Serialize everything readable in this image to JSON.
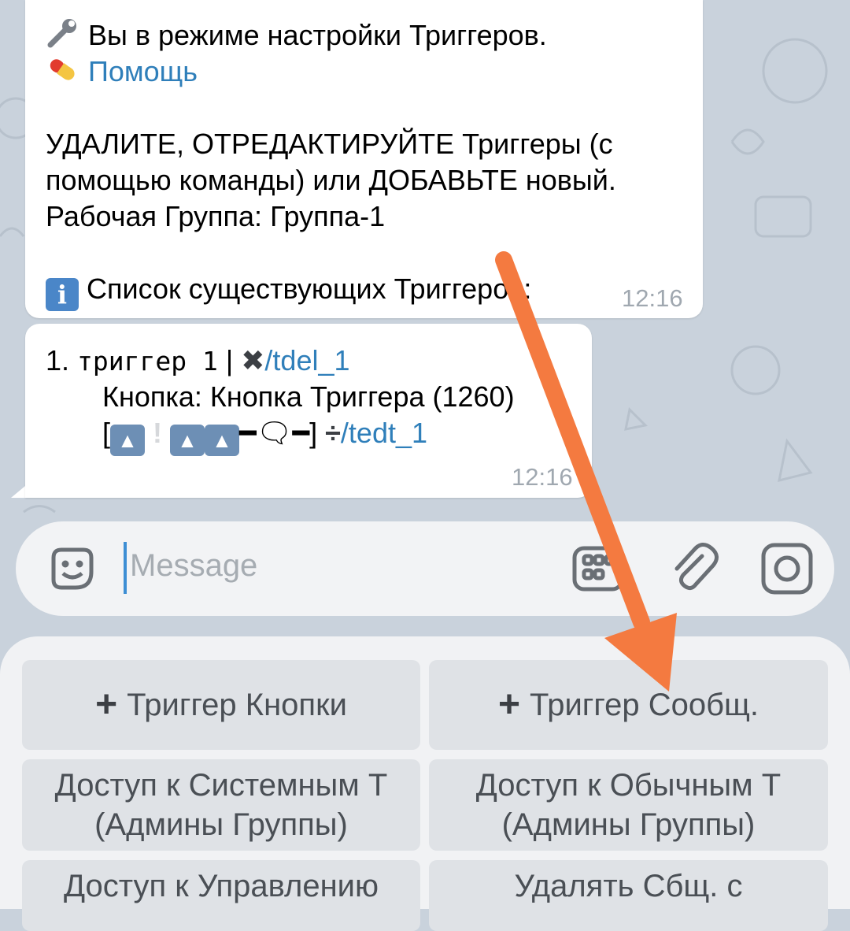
{
  "messages": {
    "first": {
      "line1": "Вы в режиме настройки Триггеров.",
      "help_link": "Помощь",
      "line3": "УДАЛИТЕ, ОТРЕДАКТИРУЙТЕ Триггеры (с",
      "line4": "помощью команды) или ДОБАВЬТЕ новый.",
      "line5": "Рабочая Группа: Группа-1",
      "line6": "Список существующих Триггеров:",
      "time": "12:16"
    },
    "second": {
      "index": "1.",
      "trigger_name": "триггер 1",
      "sep": "|",
      "del_cmd": "/tdel_1",
      "button_line": "Кнопка: Кнопка Триггера (1260)",
      "bracket_open": "[",
      "bracket_close": "]",
      "edit_cmd": "/tedt_1",
      "time": "12:16"
    }
  },
  "input": {
    "placeholder": "Message"
  },
  "keyboard": {
    "buttons": [
      "Триггер Кнопки",
      "Триггер Сообщ.",
      "Доступ к Системным Т\n(Админы Группы)",
      "Доступ к Обычным Т\n(Админы Группы)",
      "Доступ к Управлению",
      "Удалять Сбщ. с"
    ]
  },
  "colors": {
    "link": "#2f7fba",
    "arrow": "#f47a40",
    "background": "#c9d2dc"
  }
}
